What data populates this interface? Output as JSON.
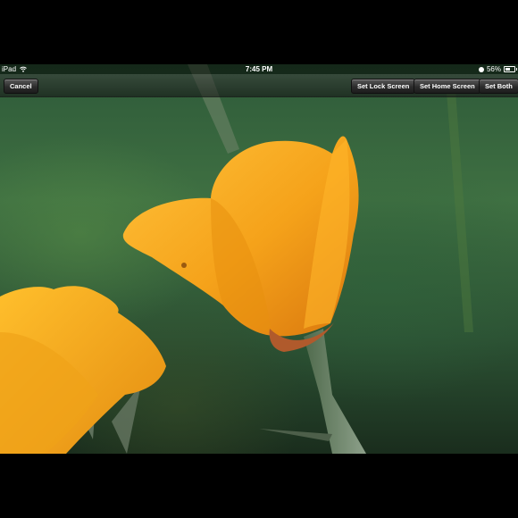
{
  "status_bar": {
    "device": "iPad",
    "time": "7:45 PM",
    "battery": "56%",
    "battery_level": 0.56
  },
  "toolbar": {
    "cancel_label": "Cancel",
    "set_lock_label": "Set Lock Screen",
    "set_home_label": "Set Home Screen",
    "set_both_label": "Set Both"
  },
  "wallpaper": {
    "subject": "orange poppy flowers",
    "colors": {
      "flower": "#f5a21a",
      "flower_dark": "#d9770e",
      "background": "#3f7042"
    }
  },
  "icons": [
    "wifi-icon",
    "orientation-lock-icon",
    "battery-icon"
  ]
}
